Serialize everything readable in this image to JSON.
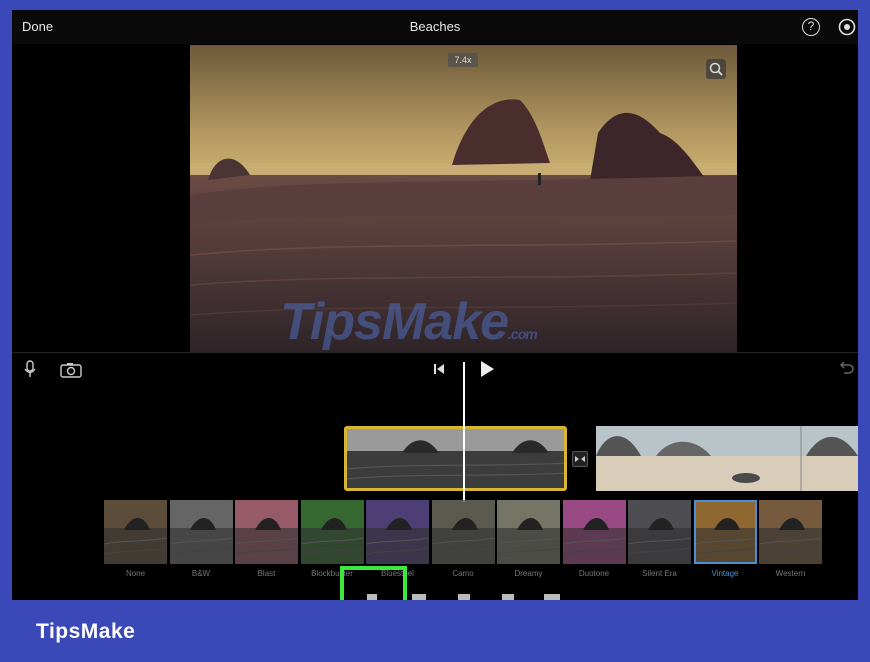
{
  "topbar": {
    "done_label": "Done",
    "title": "Beaches",
    "help_label": "?"
  },
  "viewer": {
    "zoom_badge": "7.4x"
  },
  "controls": {
    "mic_icon": "microphone-icon",
    "camera_icon": "camera-icon",
    "skip_icon": "skip-back-icon",
    "play_icon": "play-icon",
    "undo_icon": "undo-icon"
  },
  "timeline": {
    "transition_icon": "transition-icon"
  },
  "filters": [
    {
      "name": "None"
    },
    {
      "name": "B&W"
    },
    {
      "name": "Blast"
    },
    {
      "name": "Blockbuster"
    },
    {
      "name": "Bluesteel"
    },
    {
      "name": "Camo"
    },
    {
      "name": "Dreamy"
    },
    {
      "name": "Duotone"
    },
    {
      "name": "Silent Era"
    },
    {
      "name": "Vintage"
    },
    {
      "name": "Western"
    }
  ],
  "selected_filter": "Vintage",
  "accent_color": "#4d8fd6",
  "clip_border_color": "#d9b530",
  "highlight_color": "#3ee93e",
  "brand": {
    "name": "TipsMake",
    "watermark": "TipsMake",
    "watermark_suffix": ".com"
  }
}
